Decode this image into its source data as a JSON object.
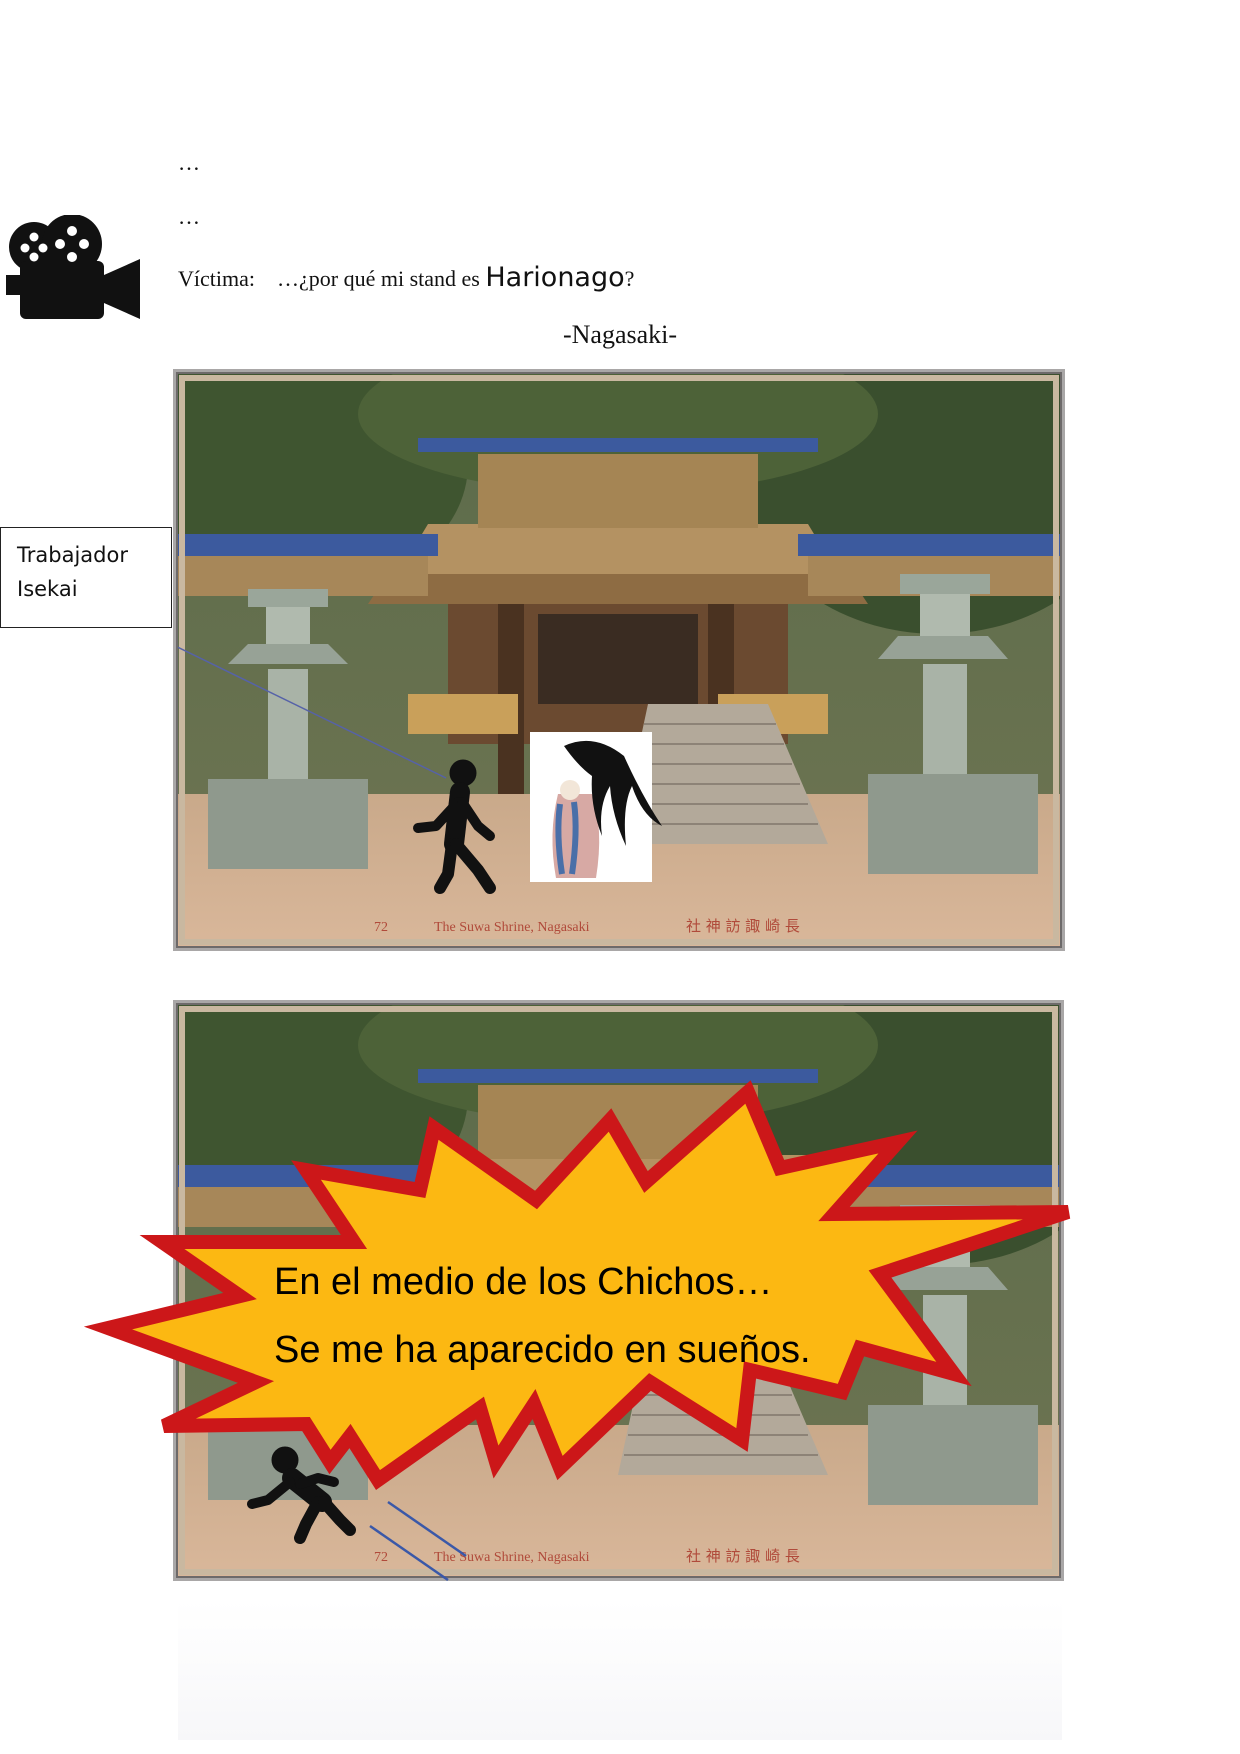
{
  "page": {
    "ellipsis_1": "…",
    "ellipsis_2": "…",
    "dialogue": {
      "speaker": "Víctima:",
      "line_start": "…¿por qué mi stand es ",
      "stand_name": "Harionago",
      "line_end": "?"
    },
    "location_caption": "-Nagasaki-"
  },
  "panel_1": {
    "postcard_caption_en": "The Suwa Shrine, Nagasaki",
    "postcard_caption_jp": "社 神 訪 諏 崎 長",
    "postcard_number": "72",
    "narration_box": {
      "line_1": "Trabajador",
      "line_2": "Isekai"
    }
  },
  "panel_2": {
    "postcard_caption_en": "The Suwa Shrine, Nagasaki",
    "postcard_caption_jp": "社 神 訪 諏 崎 長",
    "postcard_number": "72",
    "burst": {
      "line_1": "En el medio de los Chichos…",
      "line_2": "Se me ha aparecido en sueños."
    }
  },
  "colors": {
    "burst_fill": "#fcb812",
    "burst_border": "#cc1719",
    "burst_text": "#c0151b",
    "speed_lines": "#3a58a8"
  },
  "icons": {
    "camera": "movie-camera-icon",
    "walker": "walking-person-icon",
    "falling": "falling-person-icon",
    "yokai": "harionago-figure"
  }
}
